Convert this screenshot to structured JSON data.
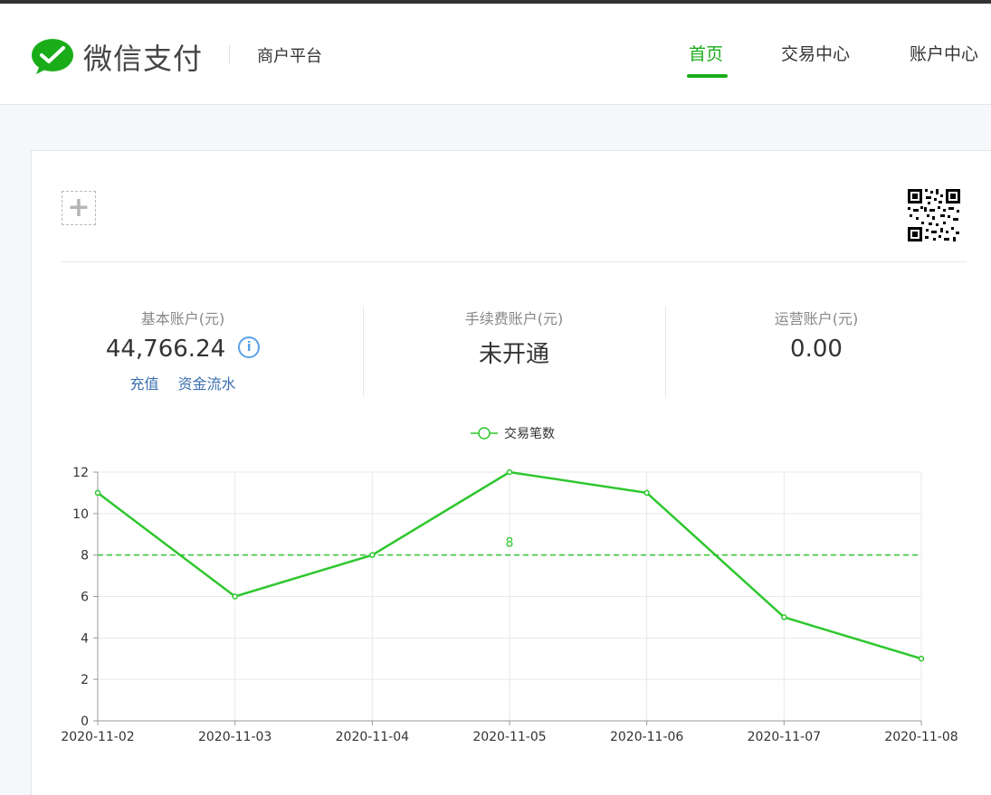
{
  "header": {
    "brand": "微信支付",
    "platform": "商户平台",
    "nav": [
      {
        "label": "首页",
        "active": true
      },
      {
        "label": "交易中心",
        "active": false
      },
      {
        "label": "账户中心",
        "active": false
      }
    ]
  },
  "accounts": [
    {
      "label": "基本账户(元)",
      "value": "44,766.24",
      "links": [
        "充值",
        "资金流水"
      ]
    },
    {
      "label": "手续费账户(元)",
      "value": "未开通"
    },
    {
      "label": "运营账户(元)",
      "value": "0.00"
    }
  ],
  "colors": {
    "accent": "#1aad19",
    "line": "#2ec72e",
    "link": "#3b6fb0"
  },
  "chart_data": {
    "type": "line",
    "categories": [
      "2020-11-02",
      "2020-11-03",
      "2020-11-04",
      "2020-11-05",
      "2020-11-06",
      "2020-11-07",
      "2020-11-08"
    ],
    "series": [
      {
        "name": "交易笔数",
        "values": [
          11,
          6,
          8,
          12,
          11,
          5,
          3
        ]
      }
    ],
    "ylim": [
      0,
      12
    ],
    "yticks": [
      0,
      2,
      4,
      6,
      8,
      10,
      12
    ],
    "average_line": {
      "value": 8,
      "label": "8",
      "style": "dashed"
    },
    "grid": true,
    "legend": "top-center"
  }
}
